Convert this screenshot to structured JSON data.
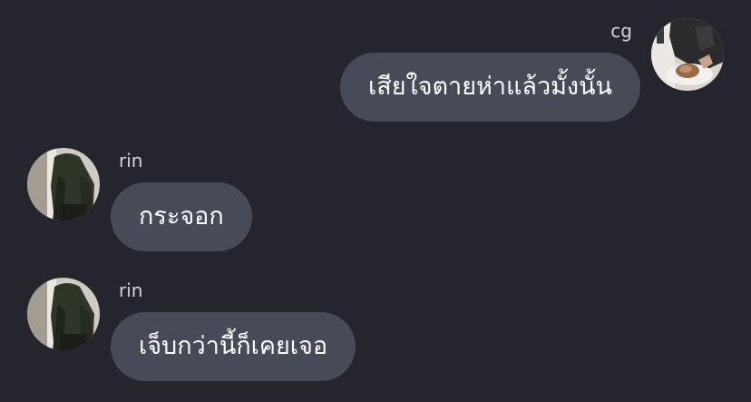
{
  "messages": [
    {
      "sender": "cg",
      "text": "เสียใจตายห่าแล้วมั้งนั้น",
      "avatar_icon": "user-avatar-photo-icon"
    },
    {
      "sender": "rin",
      "text": "กระจอก",
      "avatar_icon": "user-avatar-photo-icon"
    },
    {
      "sender": "rin",
      "text": "เจ็บกว่านี้ก็เคยเจอ",
      "avatar_icon": "user-avatar-photo-icon"
    }
  ],
  "colors": {
    "background": "#25252d",
    "bubble": "#474a57",
    "bubble_text": "#ffffff",
    "sender_name": "#d4d4da"
  }
}
